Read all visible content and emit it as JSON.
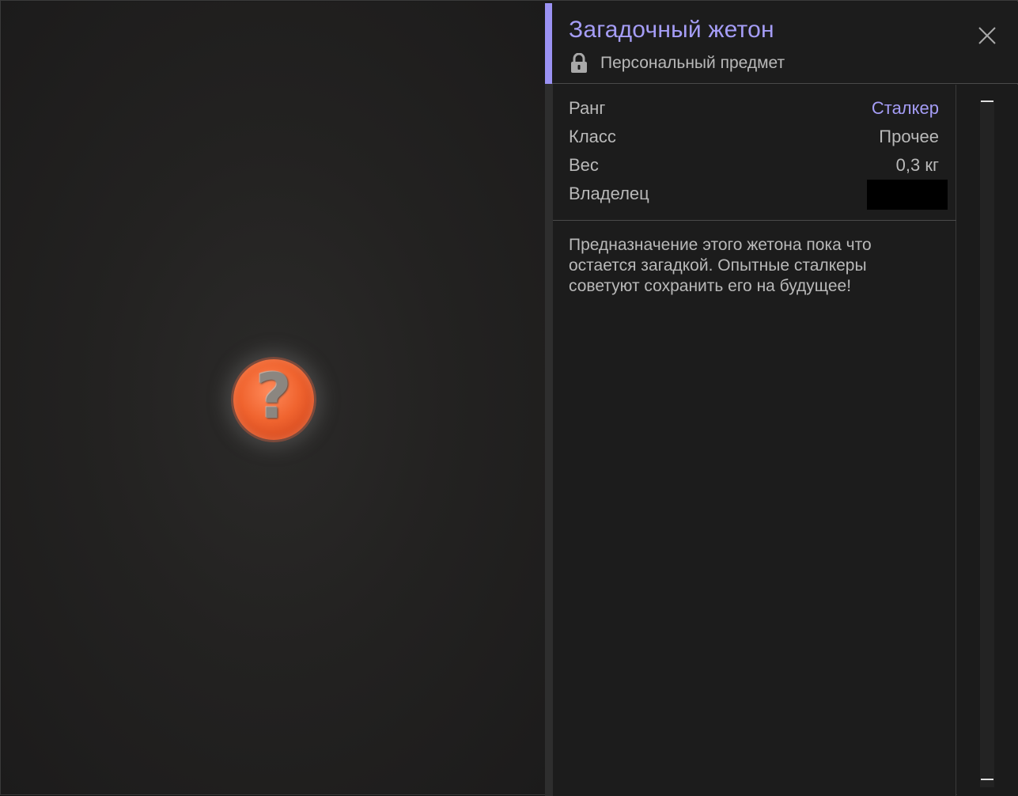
{
  "item": {
    "title": "Загадочный жетон",
    "subtitle": "Персональный предмет",
    "subtitle_icon": "lock-icon",
    "image_glyph": "?"
  },
  "stats": [
    {
      "label": "Ранг",
      "value": "Сталкер"
    },
    {
      "label": "Класс",
      "value": "Прочее"
    },
    {
      "label": "Вес",
      "value": "0,3 кг"
    },
    {
      "label": "Владелец",
      "value": ""
    }
  ],
  "description": "Предназначение этого жетона пока что остается загадкой. Опытные сталкеры советуют сохранить его на будущее!",
  "colors": {
    "accent": "#9b92f3",
    "title": "#a59df6",
    "text": "#b9b9b9",
    "background": "#1c1c1c",
    "token": "#f0642f"
  }
}
